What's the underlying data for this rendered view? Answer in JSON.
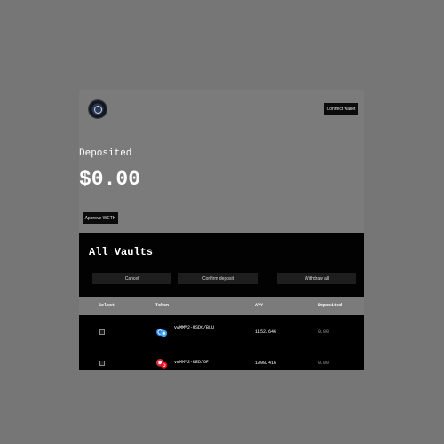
{
  "header": {
    "logo_icon": "vault-logo-icon",
    "connect_label": "Connect wallet"
  },
  "summary": {
    "deposited_label": "Deposited",
    "deposited_value": "$0.00",
    "approve_label": "Approve WETH"
  },
  "vaults": {
    "title": "All Vaults",
    "actions": {
      "cancel": "Cancel",
      "confirm": "Confirm deposit",
      "withdraw": "Withdraw all"
    },
    "columns": [
      "Select",
      "Token",
      "APY",
      "Deposited"
    ],
    "rows": [
      {
        "token": "vAMMV2-USDC/BLU",
        "apy": "1152.64%",
        "deposited": "0.00",
        "icon": "usdc-blu-pair-icon"
      },
      {
        "token": "vAMMV2-RED/OP",
        "apy": "1098.41%",
        "deposited": "0.00",
        "icon": "red-op-pair-icon"
      }
    ]
  },
  "colors": {
    "page_bg": "#767676",
    "panel_bg": "#7b7b7b",
    "vault_bg": "#020202",
    "button_bg": "#0b0b0b"
  }
}
